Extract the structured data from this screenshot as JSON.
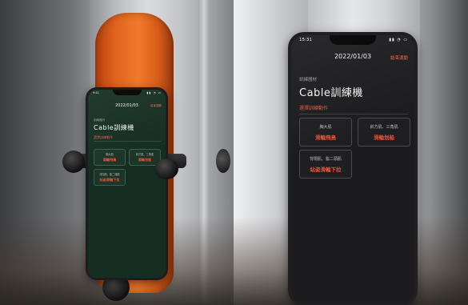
{
  "app": {
    "status_time_right": "15:31",
    "status_time_left": "9:41",
    "status_icons": "▮▮ ◔ ▭",
    "date": "2022/01/03",
    "end_action": "結束運動",
    "category_label": "訓練器材",
    "equipment_title": "Cable訓練機",
    "section_label": "選擇訓練動作",
    "exercises": [
      {
        "muscle": "胸大肌",
        "name": "滑輪飛鳥"
      },
      {
        "muscle": "斜方肌、三角肌",
        "name": "滑輪划船"
      },
      {
        "muscle": "背闊肌、肱二頭肌",
        "name": "站姿滑輪下拉"
      }
    ]
  },
  "colors": {
    "accent": "#e8533a",
    "holder": "#f07a2c",
    "screen_bg": "#1c1c1e"
  }
}
